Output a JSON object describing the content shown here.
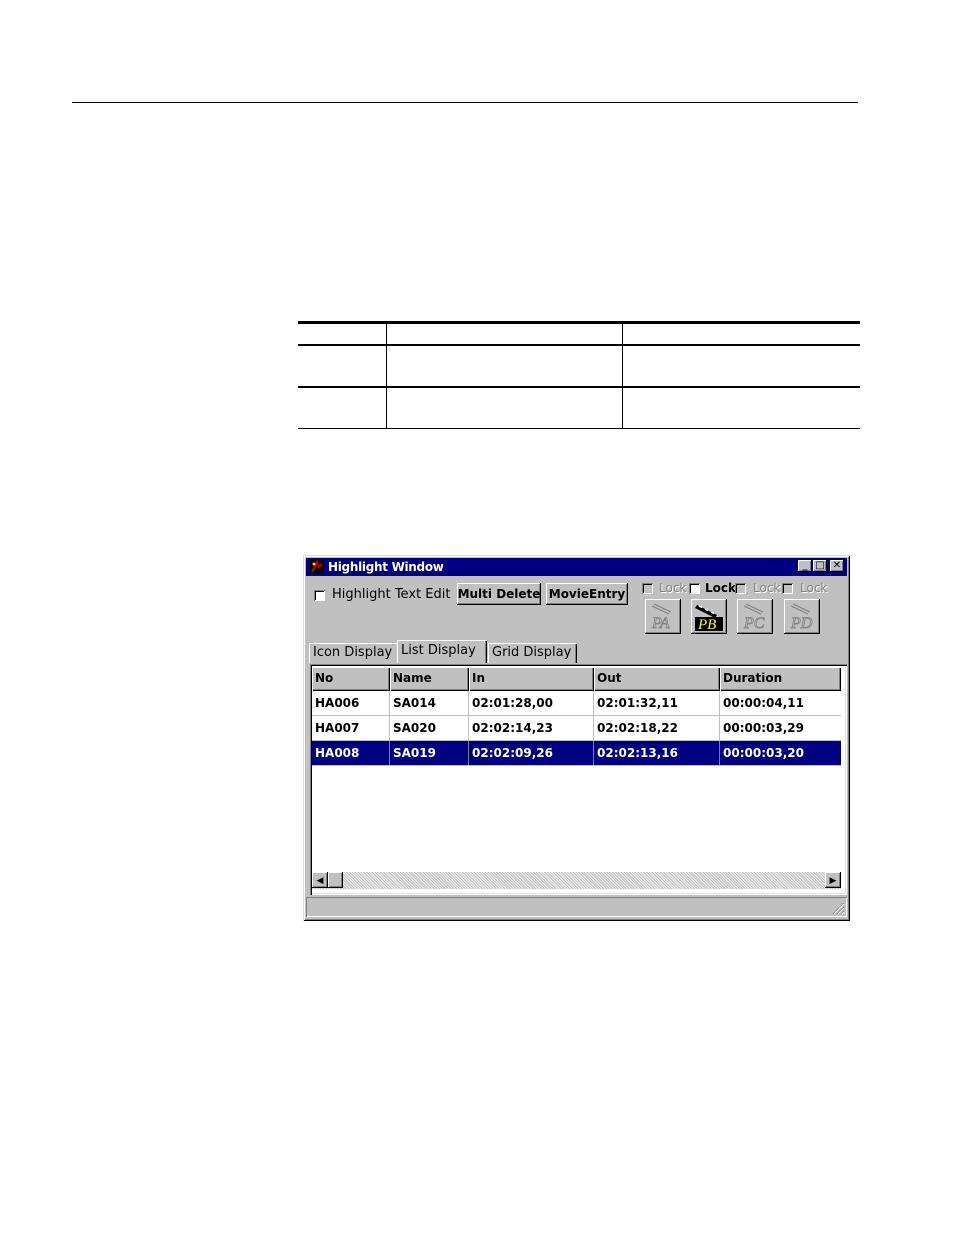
{
  "window": {
    "title": "Highlight Window",
    "minimize_glyph": "_",
    "maximize_glyph": "□",
    "close_glyph": "✕"
  },
  "toolbar": {
    "highlight_text_edit_label": "Highlight Text Edit",
    "multi_delete_label": "Multi Delete",
    "movie_entry_label": "MovieEntry",
    "locks": [
      {
        "label": "Lock",
        "enabled": false
      },
      {
        "label": "Lock",
        "enabled": true
      },
      {
        "label": "Lock",
        "enabled": false
      },
      {
        "label": "Lock",
        "enabled": false
      }
    ],
    "players": [
      {
        "label": "PA",
        "active": false
      },
      {
        "label": "PB",
        "active": true
      },
      {
        "label": "PC",
        "active": false
      },
      {
        "label": "PD",
        "active": false
      }
    ]
  },
  "tabs": [
    {
      "label": "Icon Display",
      "active": false
    },
    {
      "label": "List Display",
      "active": true
    },
    {
      "label": "Grid Display",
      "active": false
    }
  ],
  "table": {
    "columns": [
      "No",
      "Name",
      "In",
      "Out",
      "Duration"
    ],
    "rows": [
      {
        "no": "HA006",
        "name": "SA014",
        "in": "02:01:28,00",
        "out": "02:01:32,11",
        "duration": "00:00:04,11",
        "selected": false
      },
      {
        "no": "HA007",
        "name": "SA020",
        "in": "02:02:14,23",
        "out": "02:02:18,22",
        "duration": "00:00:03,29",
        "selected": false
      },
      {
        "no": "HA008",
        "name": "SA019",
        "in": "02:02:09,26",
        "out": "02:02:13,16",
        "duration": "00:00:03,20",
        "selected": true
      }
    ]
  },
  "scrollbar": {
    "left_glyph": "◀",
    "right_glyph": "▶"
  },
  "colors": {
    "titlebar": "#000080",
    "selection": "#000080",
    "face": "#c0c0c0"
  }
}
